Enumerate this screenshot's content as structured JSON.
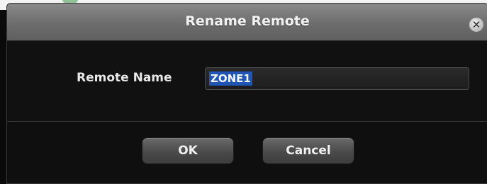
{
  "dialog": {
    "title": "Rename Remote",
    "close_icon": "close-icon"
  },
  "form": {
    "label": "Remote Name",
    "value": "ZONE1"
  },
  "buttons": {
    "ok": "OK",
    "cancel": "Cancel"
  },
  "colors": {
    "selection": "#1f55b5",
    "dialog_background": "#0f0f0f",
    "titlebar": "#6d6d6d"
  }
}
